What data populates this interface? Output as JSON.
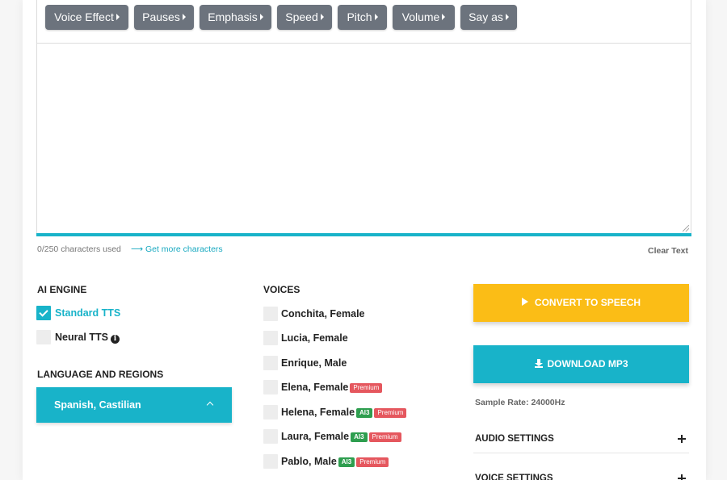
{
  "toolbar": {
    "buttons": [
      {
        "label": "Voice Effect"
      },
      {
        "label": "Pauses"
      },
      {
        "label": "Emphasis"
      },
      {
        "label": "Speed"
      },
      {
        "label": "Pitch"
      },
      {
        "label": "Volume"
      },
      {
        "label": "Say as"
      }
    ]
  },
  "editor": {
    "value": "",
    "char_count": "0/250 characters used",
    "more_chars": "⟶ Get more characters",
    "clear_text": "Clear Text"
  },
  "ai_engine": {
    "heading": "AI ENGINE",
    "options": [
      {
        "label": "Standard TTS",
        "checked": true
      },
      {
        "label": "Neural TTS",
        "checked": false
      }
    ],
    "info_glyph": "i"
  },
  "language": {
    "heading": "LANGUAGE AND REGIONS",
    "selected": "Spanish, Castilian"
  },
  "voices": {
    "heading": "VOICES",
    "items": [
      {
        "name": "Conchita, Female",
        "ai3": "",
        "premium": ""
      },
      {
        "name": "Lucia, Female",
        "ai3": "",
        "premium": ""
      },
      {
        "name": "Enrique, Male",
        "ai3": "",
        "premium": ""
      },
      {
        "name": "Elena, Female",
        "ai3": "",
        "premium": "Premium"
      },
      {
        "name": "Helena, Female",
        "ai3": "AI3",
        "premium": "Premium"
      },
      {
        "name": "Laura, Female",
        "ai3": "AI3",
        "premium": "Premium"
      },
      {
        "name": "Pablo, Male",
        "ai3": "AI3",
        "premium": "Premium"
      }
    ]
  },
  "actions": {
    "convert_label": "CONVERT TO SPEECH",
    "download_label": "DOWNLOAD MP3",
    "sample_rate": "Sample Rate: 24000Hz"
  },
  "accordion": {
    "audio_settings": "AUDIO SETTINGS",
    "voice_settings": "VOICE SETTINGS"
  },
  "colors": {
    "accent": "#18b3c9",
    "convert": "#fbbd16",
    "toolbar_button": "#6c737d",
    "premium_badge": "#e5575e",
    "ai3_badge": "#2e9e4f"
  }
}
